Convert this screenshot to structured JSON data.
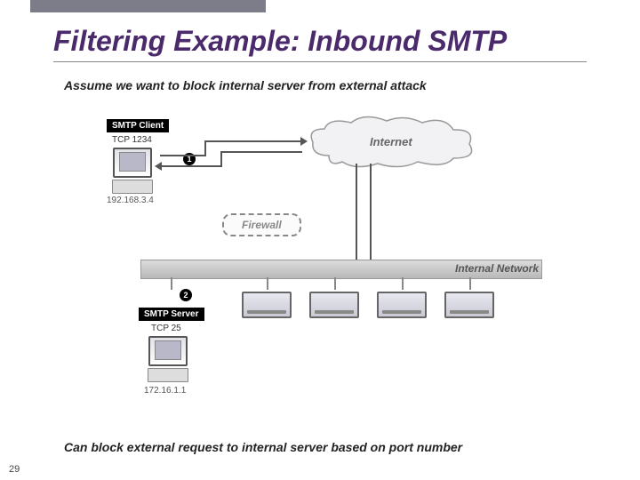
{
  "title": "Filtering Example: Inbound SMTP",
  "subtitle": "Assume we want to block internal server from external attack",
  "footnote": "Can block external request to internal server based on port number",
  "page_number": "29",
  "diagram": {
    "client_label": "SMTP Client",
    "client_port": "TCP 1234",
    "client_ip": "192.168.3.4",
    "server_label": "SMTP Server",
    "server_port": "TCP 25",
    "server_ip": "172.16.1.1",
    "cloud_label": "Internet",
    "firewall_label": "Firewall",
    "network_label": "Internal Network",
    "badge1": "1",
    "badge2": "2"
  }
}
